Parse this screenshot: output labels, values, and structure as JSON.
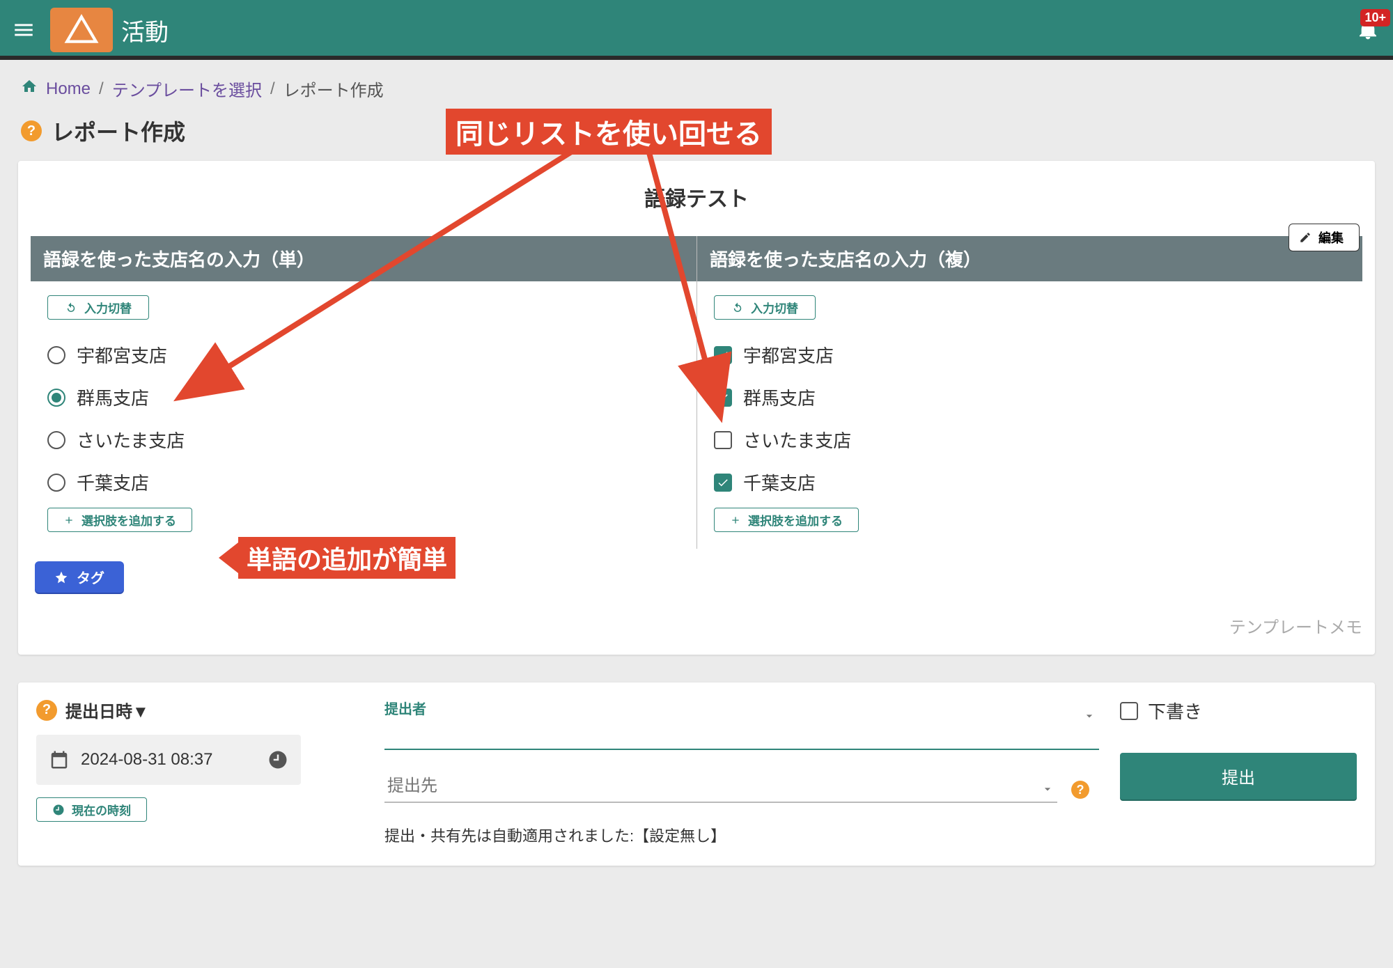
{
  "header": {
    "title": "活動",
    "badge": "10+"
  },
  "breadcrumbs": {
    "home": "Home",
    "template_select": "テンプレートを選択",
    "current": "レポート作成"
  },
  "page_title": "レポート作成",
  "card": {
    "title": "語録テスト",
    "edit_label": "編集",
    "memo": "テンプレートメモ",
    "tag_label": "タグ",
    "left": {
      "header": "語録を使った支店名の入力（単）",
      "switch_label": "入力切替",
      "options": [
        {
          "label": "宇都宮支店",
          "checked": false
        },
        {
          "label": "群馬支店",
          "checked": true
        },
        {
          "label": "さいたま支店",
          "checked": false
        },
        {
          "label": "千葉支店",
          "checked": false
        }
      ],
      "add_label": "選択肢を追加する"
    },
    "right": {
      "header": "語録を使った支店名の入力（複）",
      "switch_label": "入力切替",
      "options": [
        {
          "label": "宇都宮支店",
          "checked": true
        },
        {
          "label": "群馬支店",
          "checked": true
        },
        {
          "label": "さいたま支店",
          "checked": false
        },
        {
          "label": "千葉支店",
          "checked": true
        }
      ],
      "add_label": "選択肢を追加する"
    }
  },
  "annotations": {
    "top": "同じリストを使い回せる",
    "add": "単語の追加が簡単"
  },
  "footer": {
    "datetime_label": "提出日時▼",
    "datetime_value": "2024-08-31 08:37",
    "now_label": "現在の時刻",
    "submitter_label": "提出者",
    "submitter_value": "",
    "dest_label": "提出先",
    "auto_note": "提出・共有先は自動適用されました:【設定無し】",
    "draft_label": "下書き",
    "submit_label": "提出"
  },
  "colors": {
    "primary": "#2f8579",
    "accent_orange": "#e78641",
    "annotation": "#e2472e",
    "link": "#6a4d9e",
    "help": "#f29b2e",
    "tag_blue": "#3b62d6",
    "badge_red": "#d32424"
  }
}
